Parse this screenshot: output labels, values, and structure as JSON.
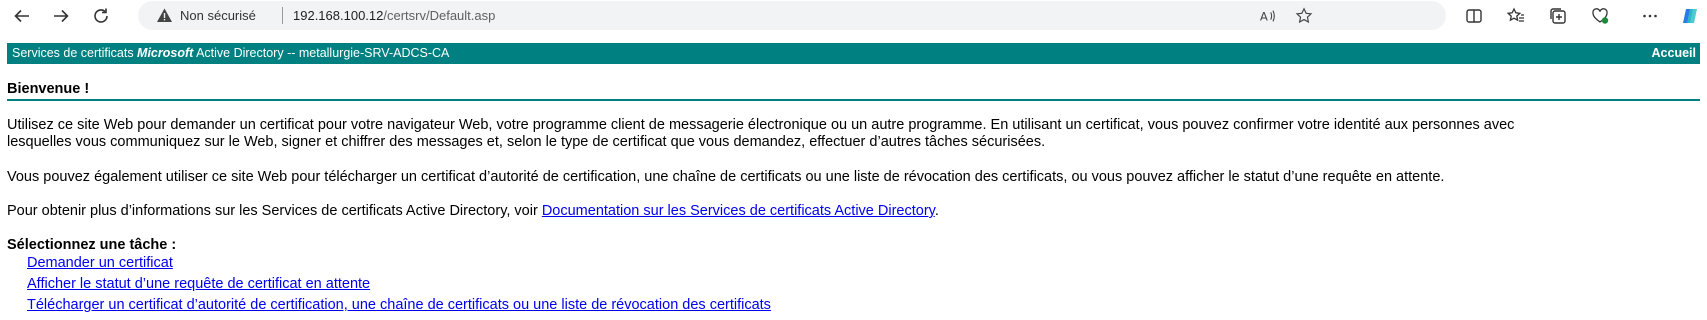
{
  "browser": {
    "security_label": "Non sécurisé",
    "url_host": "192.168.100.12",
    "url_path": "/certsrv/Default.asp"
  },
  "header": {
    "title_prefix": "Services de certificats ",
    "title_brand": "Microsoft",
    "title_suffix": " Active Directory  --  metallurgie-SRV-ADCS-CA",
    "home_link": "Accueil"
  },
  "main": {
    "welcome": "Bienvenue !",
    "paragraph1_line1": "Utilisez ce site Web pour demander un certificat pour votre navigateur Web, votre programme client de messagerie électronique ou un autre programme. En utilisant un certificat, vous pouvez confirmer votre identité aux personnes avec",
    "paragraph1_line2": "lesquelles vous communiquez sur le Web, signer et chiffrer des messages et, selon le type de certificat que vous demandez, effectuer d’autres tâches sécurisées.",
    "paragraph2": "Vous pouvez également utiliser ce site Web pour télécharger un certificat d’autorité de certification, une chaîne de certificats ou une liste de révocation des certificats, ou vous pouvez afficher le statut d’une requête en attente.",
    "paragraph3_text": "Pour obtenir plus d’informations sur les Services de certificats Active Directory, voir ",
    "paragraph3_link": "Documentation sur les Services de certificats Active Directory",
    "paragraph3_end": ".",
    "tasks_title": "Sélectionnez une tâche :",
    "tasks": [
      "Demander un certificat",
      "Afficher le statut d’une requête de certificat en attente",
      "Télécharger un certificat d’autorité de certification, une chaîne de certificats ou une liste de révocation des certificats"
    ]
  },
  "colors": {
    "header_bg": "#008080",
    "link": "#0000ee"
  }
}
